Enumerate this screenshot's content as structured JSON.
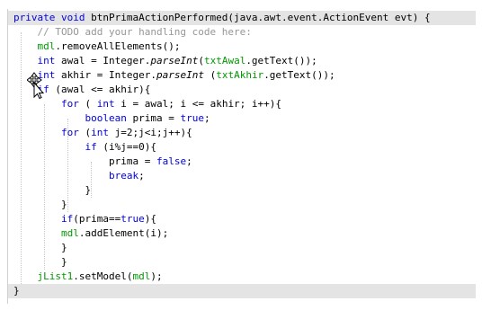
{
  "editor": {
    "lines": [
      {
        "tokens": [
          {
            "text": "private void ",
            "cls": "kw"
          },
          {
            "text": "btnPrimaActionPerformed",
            "cls": ""
          },
          {
            "text": "(java.awt.event.ActionEvent evt) {",
            "cls": ""
          }
        ]
      },
      {
        "tokens": [
          {
            "text": "    // TODO add your handling code here:",
            "cls": "cm"
          }
        ]
      },
      {
        "tokens": [
          {
            "text": "    ",
            "cls": ""
          },
          {
            "text": "mdl",
            "cls": "fd"
          },
          {
            "text": ".removeAllElements();",
            "cls": ""
          }
        ]
      },
      {
        "tokens": [
          {
            "text": "    ",
            "cls": ""
          },
          {
            "text": "int",
            "cls": "kw"
          },
          {
            "text": " awal = Integer.",
            "cls": ""
          },
          {
            "text": "parseInt",
            "cls": "it"
          },
          {
            "text": "(",
            "cls": ""
          },
          {
            "text": "txtAwal",
            "cls": "fd"
          },
          {
            "text": ".getText());",
            "cls": ""
          }
        ]
      },
      {
        "tokens": [
          {
            "text": "    ",
            "cls": ""
          },
          {
            "text": "int",
            "cls": "kw"
          },
          {
            "text": " akhir = Integer.",
            "cls": ""
          },
          {
            "text": "parseInt",
            "cls": "it"
          },
          {
            "text": " (",
            "cls": ""
          },
          {
            "text": "txtAkhir",
            "cls": "fd"
          },
          {
            "text": ".getText());",
            "cls": ""
          }
        ]
      },
      {
        "tokens": [
          {
            "text": "    ",
            "cls": ""
          },
          {
            "text": "if",
            "cls": "kw"
          },
          {
            "text": " (awal <= akhir){",
            "cls": ""
          }
        ]
      },
      {
        "tokens": [
          {
            "text": "        ",
            "cls": ""
          },
          {
            "text": "for",
            "cls": "kw"
          },
          {
            "text": " ( ",
            "cls": ""
          },
          {
            "text": "int",
            "cls": "kw"
          },
          {
            "text": " i = awal; i <= akhir; i++){",
            "cls": ""
          }
        ]
      },
      {
        "tokens": [
          {
            "text": "            ",
            "cls": ""
          },
          {
            "text": "boolean",
            "cls": "kw"
          },
          {
            "text": " prima = ",
            "cls": ""
          },
          {
            "text": "true",
            "cls": "kw"
          },
          {
            "text": ";",
            "cls": ""
          }
        ]
      },
      {
        "tokens": [
          {
            "text": "        ",
            "cls": ""
          },
          {
            "text": "for",
            "cls": "kw"
          },
          {
            "text": " (",
            "cls": ""
          },
          {
            "text": "int",
            "cls": "kw"
          },
          {
            "text": " j=2;j<i;j++){",
            "cls": ""
          }
        ]
      },
      {
        "tokens": [
          {
            "text": "            ",
            "cls": ""
          },
          {
            "text": "if",
            "cls": "kw"
          },
          {
            "text": " (i%j==0){",
            "cls": ""
          }
        ]
      },
      {
        "tokens": [
          {
            "text": "                prima = ",
            "cls": ""
          },
          {
            "text": "false",
            "cls": "kw"
          },
          {
            "text": ";",
            "cls": ""
          }
        ]
      },
      {
        "tokens": [
          {
            "text": "                ",
            "cls": ""
          },
          {
            "text": "break",
            "cls": "kw"
          },
          {
            "text": ";",
            "cls": ""
          }
        ]
      },
      {
        "tokens": [
          {
            "text": "            }",
            "cls": ""
          }
        ]
      },
      {
        "tokens": [
          {
            "text": "        }",
            "cls": ""
          }
        ]
      },
      {
        "tokens": [
          {
            "text": "        ",
            "cls": ""
          },
          {
            "text": "if",
            "cls": "kw"
          },
          {
            "text": "(prima==",
            "cls": ""
          },
          {
            "text": "true",
            "cls": "kw"
          },
          {
            "text": "){",
            "cls": ""
          }
        ]
      },
      {
        "tokens": [
          {
            "text": "        ",
            "cls": ""
          },
          {
            "text": "mdl",
            "cls": "fd"
          },
          {
            "text": ".addElement(i);",
            "cls": ""
          }
        ]
      },
      {
        "tokens": [
          {
            "text": "        }",
            "cls": ""
          }
        ]
      },
      {
        "tokens": [
          {
            "text": "        }",
            "cls": ""
          }
        ]
      },
      {
        "tokens": [
          {
            "text": "    ",
            "cls": ""
          },
          {
            "text": "jList1",
            "cls": "fd"
          },
          {
            "text": ".setModel(",
            "cls": ""
          },
          {
            "text": "mdl",
            "cls": "fd"
          },
          {
            "text": ");",
            "cls": ""
          }
        ]
      },
      {
        "tokens": [
          {
            "text": "}",
            "cls": ""
          }
        ]
      }
    ],
    "highlighted_lines": [
      0,
      19
    ]
  },
  "colors": {
    "keyword": "#0000e6",
    "comment": "#969696",
    "field": "#009900",
    "highlight": "#e4e4e4"
  },
  "cursor": {
    "icon": "move-cursor-icon"
  }
}
